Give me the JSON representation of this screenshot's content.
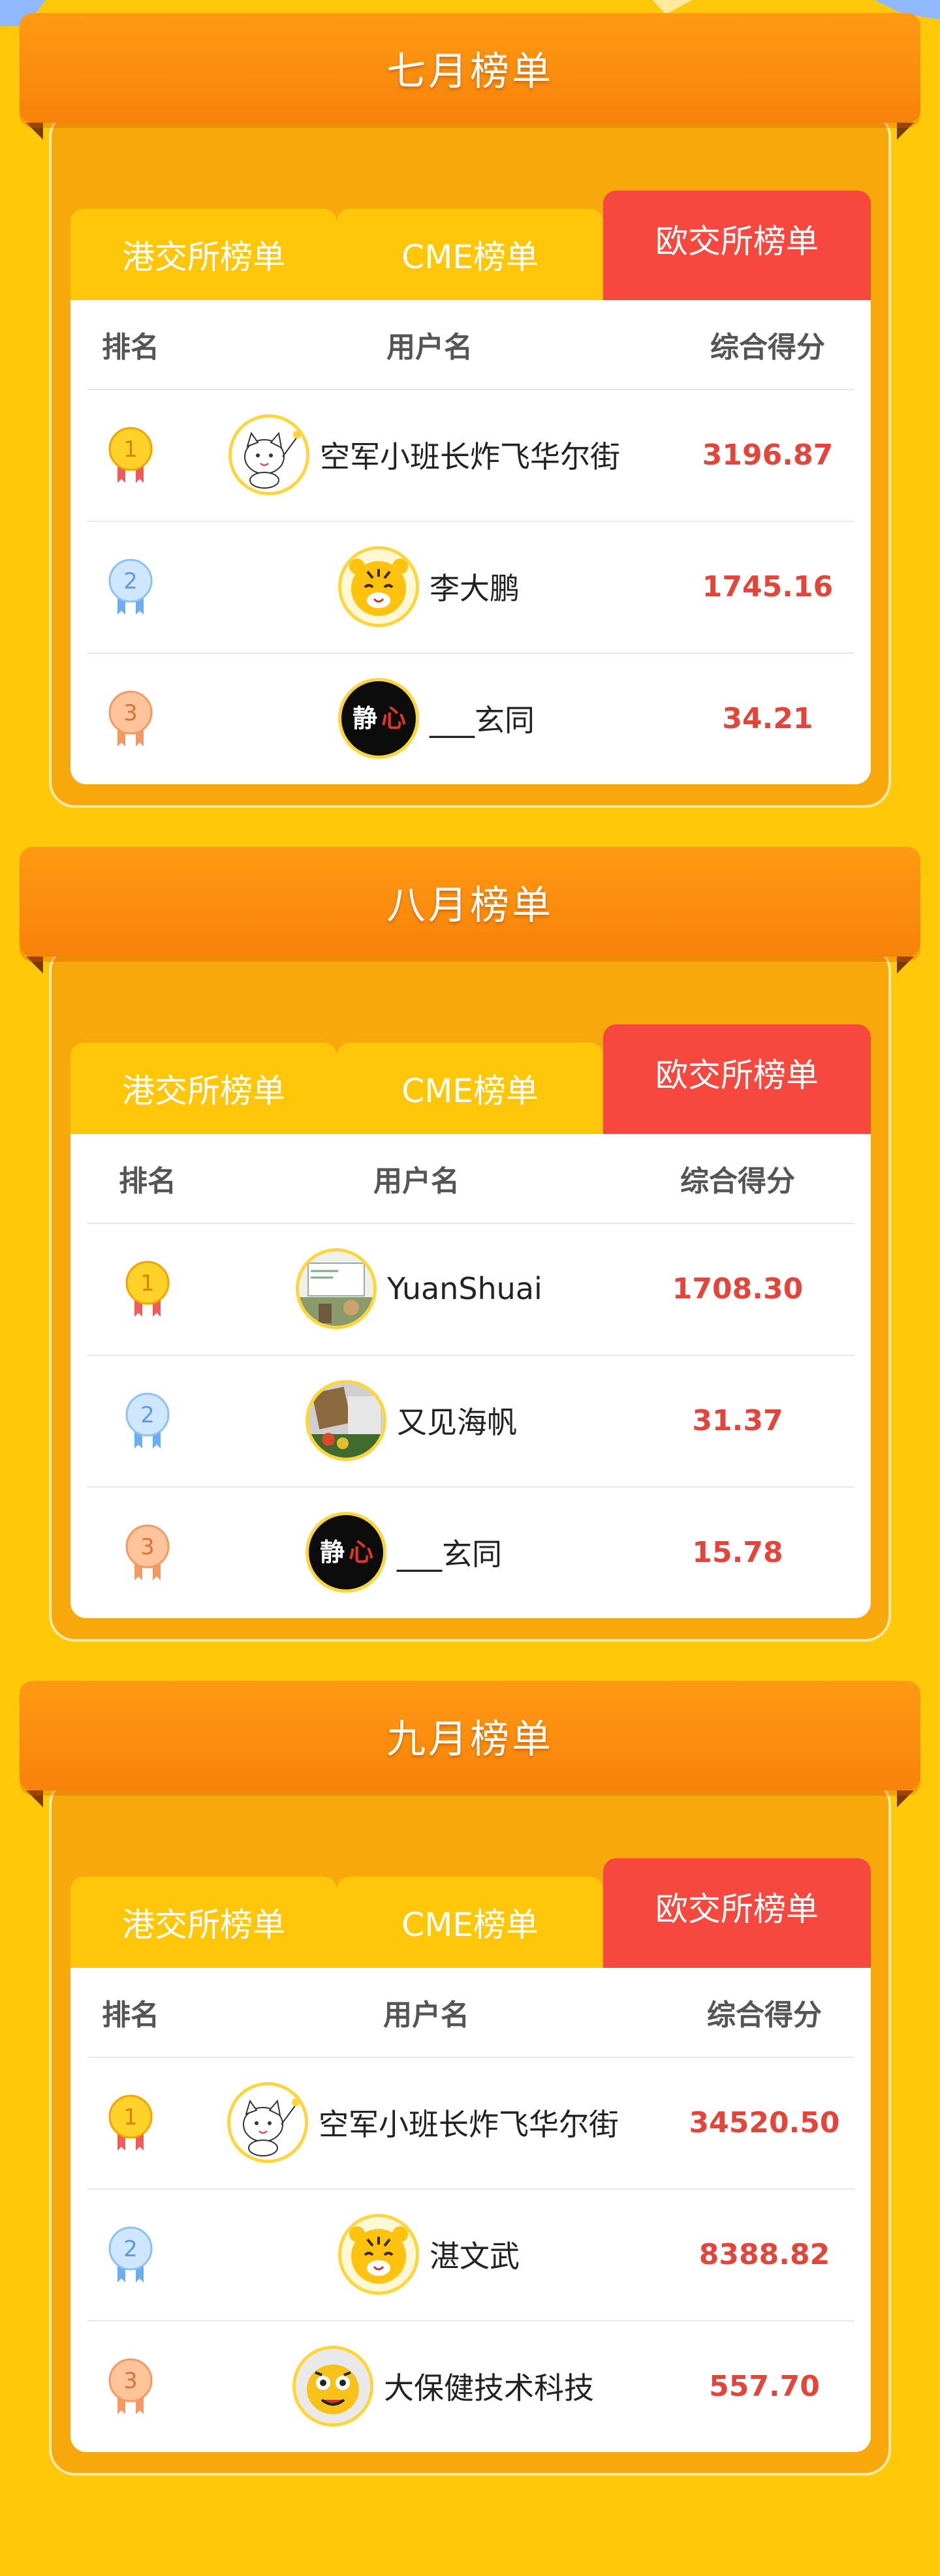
{
  "tab_labels": [
    "港交所榜单",
    "CME榜单",
    "欧交所榜单"
  ],
  "headers": {
    "rank": "排名",
    "user": "用户名",
    "score": "综合得分"
  },
  "colors": {
    "background": "#ffc90a",
    "banner": "#f7820a",
    "active_tab": "#f7483f",
    "score": "#e4453b"
  },
  "sections": [
    {
      "title": "七月榜单",
      "rows": [
        {
          "rank": "1",
          "avatar": "cat-avatar",
          "name": "空军小班长炸飞华尔街",
          "score": "3196.87"
        },
        {
          "rank": "2",
          "avatar": "tiger-avatar",
          "name": "李大鹏",
          "score": "1745.16"
        },
        {
          "rank": "3",
          "avatar": "calligraphy-avatar",
          "avatar_text": "静心",
          "name": "___玄同",
          "score": "34.21"
        }
      ]
    },
    {
      "title": "八月榜单",
      "rows": [
        {
          "rank": "1",
          "avatar": "photo-avatar",
          "name": "YuanShuai",
          "score": "1708.30"
        },
        {
          "rank": "2",
          "avatar": "photo-avatar-2",
          "name": "又见海帆",
          "score": "31.37"
        },
        {
          "rank": "3",
          "avatar": "calligraphy-avatar",
          "avatar_text": "静心",
          "name": "___玄同",
          "score": "15.78"
        }
      ]
    },
    {
      "title": "九月榜单",
      "rows": [
        {
          "rank": "1",
          "avatar": "cat-avatar",
          "name": "空军小班长炸飞华尔街",
          "score": "34520.50"
        },
        {
          "rank": "2",
          "avatar": "tiger-avatar",
          "name": "湛文武",
          "score": "8388.82"
        },
        {
          "rank": "3",
          "avatar": "tiger-avatar-2",
          "name": "大保健技术科技",
          "score": "557.70"
        }
      ]
    }
  ]
}
